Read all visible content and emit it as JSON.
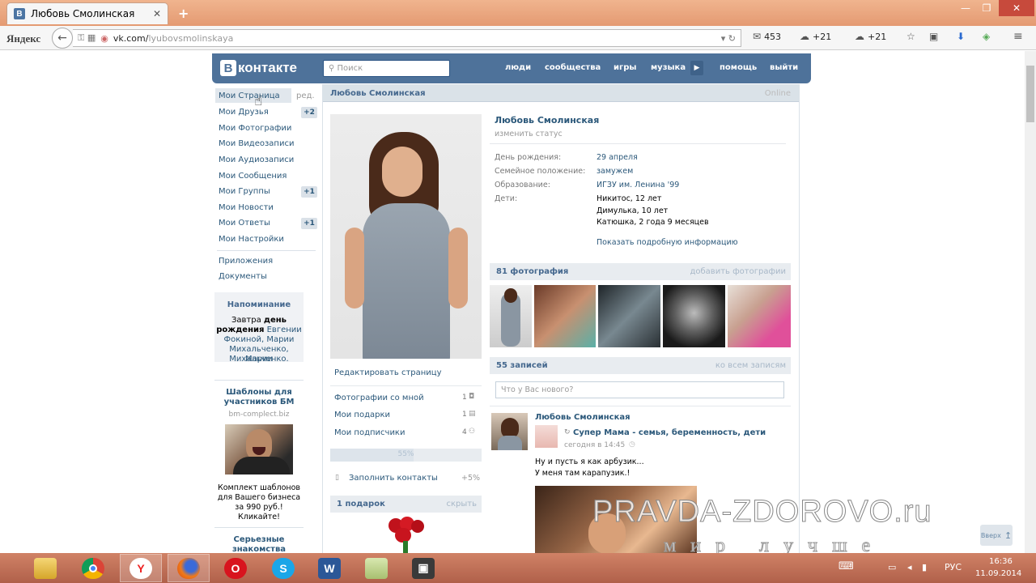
{
  "browser": {
    "tab_title": "Любовь Смолинская",
    "tab_close": "✕",
    "new_tab": "+",
    "win_min": "—",
    "win_max": "❐",
    "win_close": "✕",
    "yandex_logo": "Яндекс",
    "url_domain": "vk.com/",
    "url_path": "lyubovsmolinskaya",
    "mail_count": "453",
    "weather1": "+21",
    "weather2": "+21"
  },
  "vk": {
    "logo_text": "контакте",
    "logo_b": "В",
    "search_placeholder": "Поиск",
    "nav": [
      "люди",
      "сообщества",
      "игры",
      "музыка",
      "помощь",
      "выйти"
    ],
    "left_menu": [
      {
        "label": "Мои Страница",
        "badge": ""
      },
      {
        "label": "Мои Друзья",
        "badge": "+2"
      },
      {
        "label": "Мои Фотографии",
        "badge": ""
      },
      {
        "label": "Мои Видеозаписи",
        "badge": ""
      },
      {
        "label": "Мои Аудиозаписи",
        "badge": ""
      },
      {
        "label": "Мои Сообщения",
        "badge": ""
      },
      {
        "label": "Мои Группы",
        "badge": "+1"
      },
      {
        "label": "Мои Новости",
        "badge": ""
      },
      {
        "label": "Мои Ответы",
        "badge": "+1"
      },
      {
        "label": "Мои Настройки",
        "badge": ""
      }
    ],
    "edit_link": "ред.",
    "extra_menu": [
      "Приложения",
      "Документы"
    ],
    "reminder": {
      "title": "Напоминание",
      "l1_a": "Завтра ",
      "l1_b": "день",
      "l2_a": "рождения",
      "l2_b": " Евгении",
      "l3": "Фокиной, Марии",
      "l4": "Михальченко, Марии",
      "l5": "Михальченко."
    },
    "ad": {
      "title_l1": "Шаблоны для",
      "title_l2": "участников БМ",
      "site": "bm-complect.biz",
      "text_l1": "Комплект шаблонов",
      "text_l2": "для Вашего бизнеса",
      "text_l3": "за 990 руб.!",
      "text_l4": "Кликайте!"
    },
    "ad2_title_l1": "Серьезные",
    "ad2_title_l2": "знакомства",
    "page_header_name": "Любовь Смолинская",
    "page_header_right": "Online",
    "profile": {
      "name": "Любовь Смолинская",
      "status": "изменить статус",
      "rows": [
        {
          "label": "День рождения:",
          "value": "29 апреля"
        },
        {
          "label": "Семейное положение:",
          "value": "замужем"
        },
        {
          "label": "Образование:",
          "value": "ИГЗУ им. Ленина '99"
        }
      ],
      "children_label": "Дети:",
      "children": [
        "Никитос, 12 лет",
        "Димулька, 10 лет",
        "Катюшка, 2 года 9 месяцев"
      ],
      "more_info": "Показать подробную информацию"
    },
    "photos_section": {
      "count": "81 фотография",
      "action": "добавить фотографии"
    },
    "posts_section": {
      "count": "55 записей",
      "action": "ко всем записям"
    },
    "wall_placeholder": "Что у Вас нового?",
    "post": {
      "author": "Любовь Смолинская",
      "repost_icon": "↻",
      "group": "Супер Мама - семья, беременность, дети",
      "time": "сегодня в 14:45",
      "text_l1": "Ну и пусть я как арбузик...",
      "text_l2": "У меня там карапузик.!"
    },
    "below_photo": {
      "edit_page": "Редактировать страницу",
      "links": [
        {
          "label": "Фотографии со мной",
          "count": "1"
        },
        {
          "label": "Мои подарки",
          "count": "1"
        },
        {
          "label": "Мои подписчики",
          "count": "4"
        }
      ],
      "progress_label": "55%",
      "progress_value": 0.55,
      "fill_contacts": "Заполнить контакты",
      "fill_percent": "+5%",
      "gifts_title": "1 подарок",
      "gifts_hide": "скрыть"
    },
    "scroll_up": "Вверх",
    "scroll_up_arrow": "↥"
  },
  "watermark": {
    "l1": "PRAVDA-ZDOROVO.ru",
    "l2": "мир лучше"
  },
  "taskbar": {
    "apps": [
      "explorer",
      "chrome",
      "yandex",
      "firefox",
      "opera",
      "skype",
      "word",
      "notepad",
      "media"
    ],
    "lang": "РУС",
    "time": "16:36",
    "date": "11.09.2014"
  },
  "colors": {
    "vk_blue": "#4e729a",
    "vk_link": "#2b587a",
    "taskbar": "#c07057"
  }
}
